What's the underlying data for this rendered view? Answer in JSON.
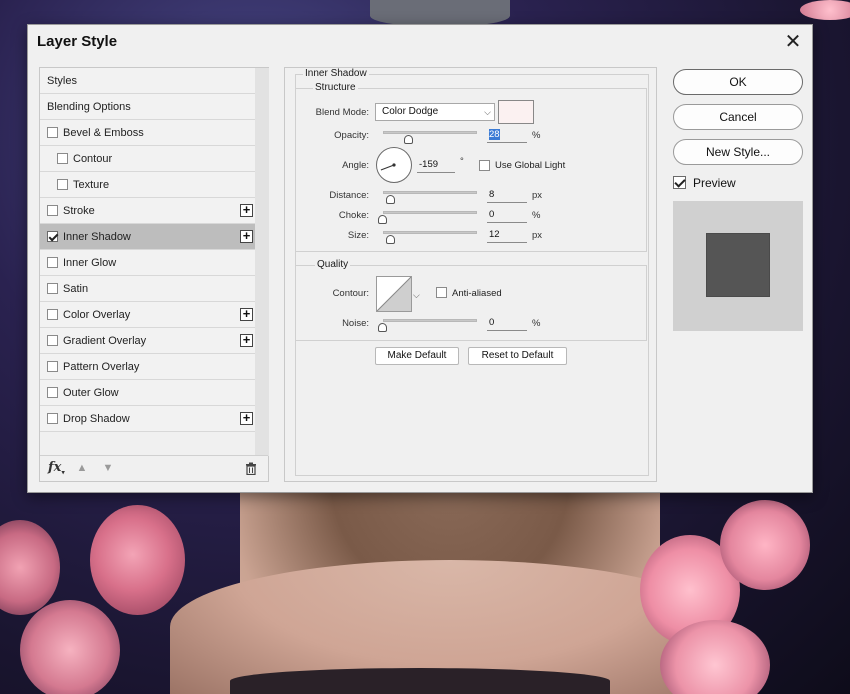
{
  "dialog": {
    "title": "Layer Style",
    "close_label": "✕"
  },
  "style_list": {
    "items": [
      {
        "label": "Styles",
        "checkbox": false,
        "checked": false,
        "plus": false,
        "indent": false,
        "selected": false
      },
      {
        "label": "Blending Options",
        "checkbox": false,
        "checked": false,
        "plus": false,
        "indent": false,
        "selected": false
      },
      {
        "label": "Bevel & Emboss",
        "checkbox": true,
        "checked": false,
        "plus": false,
        "indent": false,
        "selected": false
      },
      {
        "label": "Contour",
        "checkbox": true,
        "checked": false,
        "plus": false,
        "indent": true,
        "selected": false
      },
      {
        "label": "Texture",
        "checkbox": true,
        "checked": false,
        "plus": false,
        "indent": true,
        "selected": false
      },
      {
        "label": "Stroke",
        "checkbox": true,
        "checked": false,
        "plus": true,
        "indent": false,
        "selected": false
      },
      {
        "label": "Inner Shadow",
        "checkbox": true,
        "checked": true,
        "plus": true,
        "indent": false,
        "selected": true
      },
      {
        "label": "Inner Glow",
        "checkbox": true,
        "checked": false,
        "plus": false,
        "indent": false,
        "selected": false
      },
      {
        "label": "Satin",
        "checkbox": true,
        "checked": false,
        "plus": false,
        "indent": false,
        "selected": false
      },
      {
        "label": "Color Overlay",
        "checkbox": true,
        "checked": false,
        "plus": true,
        "indent": false,
        "selected": false
      },
      {
        "label": "Gradient Overlay",
        "checkbox": true,
        "checked": false,
        "plus": true,
        "indent": false,
        "selected": false
      },
      {
        "label": "Pattern Overlay",
        "checkbox": true,
        "checked": false,
        "plus": false,
        "indent": false,
        "selected": false
      },
      {
        "label": "Outer Glow",
        "checkbox": true,
        "checked": false,
        "plus": false,
        "indent": false,
        "selected": false
      },
      {
        "label": "Drop Shadow",
        "checkbox": true,
        "checked": false,
        "plus": true,
        "indent": false,
        "selected": false
      }
    ],
    "footer": {
      "fx_label": "fx",
      "up_icon": "arrow-up-icon",
      "down_icon": "arrow-down-icon",
      "trash_icon": "trash-icon"
    }
  },
  "inner_shadow": {
    "section_title": "Inner Shadow",
    "structure": {
      "title": "Structure",
      "blend_mode_label": "Blend Mode:",
      "blend_mode_value": "Color Dodge",
      "blend_color": "#fbf1f1",
      "opacity_label": "Opacity:",
      "opacity_value": "28",
      "opacity_unit": "%",
      "opacity_fraction": 0.28,
      "angle_label": "Angle:",
      "angle_value": "-159",
      "angle_unit": "°",
      "angle_degrees": -159,
      "use_global_light_label": "Use Global Light",
      "use_global_light": false,
      "distance_label": "Distance:",
      "distance_value": "8",
      "distance_unit": "px",
      "distance_fraction": 0.08,
      "choke_label": "Choke:",
      "choke_value": "0",
      "choke_unit": "%",
      "choke_fraction": 0,
      "size_label": "Size:",
      "size_value": "12",
      "size_unit": "px",
      "size_fraction": 0.09
    },
    "quality": {
      "title": "Quality",
      "contour_label": "Contour:",
      "anti_aliased_label": "Anti-aliased",
      "anti_aliased": false,
      "noise_label": "Noise:",
      "noise_value": "0",
      "noise_unit": "%",
      "noise_fraction": 0
    },
    "make_default_label": "Make Default",
    "reset_default_label": "Reset to Default"
  },
  "actions": {
    "ok_label": "OK",
    "cancel_label": "Cancel",
    "new_style_label": "New Style...",
    "preview_label": "Preview",
    "preview_checked": true,
    "preview_color": "#555555"
  }
}
